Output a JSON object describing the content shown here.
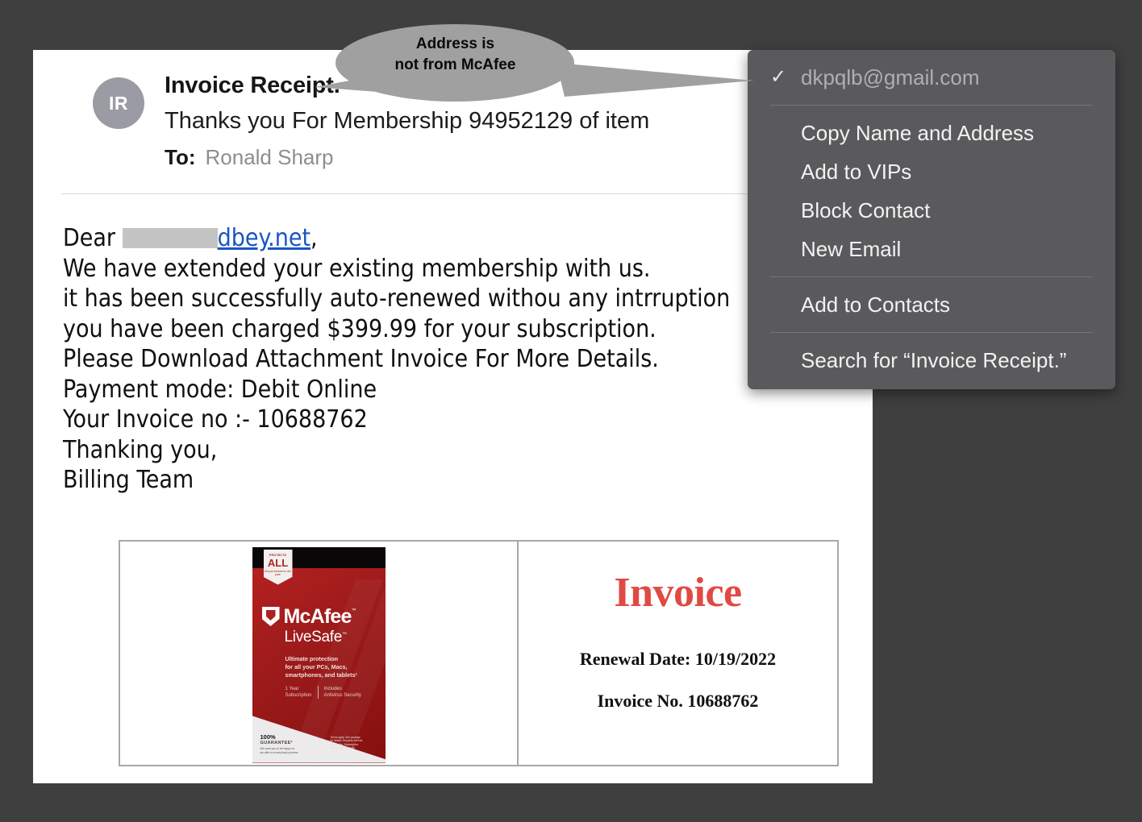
{
  "email": {
    "avatar_initials": "IR",
    "subject": "Invoice Receipt.",
    "preview": "Thanks you For Membership 94952129 of item",
    "to_label": "To:",
    "to_value": "Ronald Sharp",
    "body_lines": {
      "greeting_prefix": "Dear ",
      "greeting_link": "dbey.net",
      "greeting_suffix": ",",
      "line2": "We have extended your existing membership with us.",
      "line3": "it has been successfully auto-renewed withou any intrruption",
      "line4": "you have been charged $399.99 for your subscription.",
      "line5": "Please Download Attachment Invoice For More Details.",
      "line6": "Payment mode: Debit Online",
      "line7": "Your Invoice no :- 10688762",
      "line8": "Thanking you,",
      "line9": "Billing Team"
    }
  },
  "invoice": {
    "title": "Invoice",
    "renewal_date": "Renewal Date: 10/19/2022",
    "invoice_number": "Invoice No. 10688762",
    "title_color": "#e04a44"
  },
  "product_box": {
    "badge_top": "PROTECTS",
    "badge_main": "ALL",
    "badge_bottom": "All your devices\nfor one price",
    "brand": "McAfee",
    "brand_tm": "™",
    "product": "LiveSafe",
    "product_tm": "™",
    "description": "Ultimate protection\nfor all your PCs, Macs,\nsmartphones, and tablets¹",
    "meta_left": "1 Year\nSubscription",
    "meta_right": "Includes\nAntivirus Security",
    "guarantee_title": "100%",
    "guarantee_sub": "GUARANTEE²",
    "guarantee_note": "We want you to be happy so\nwe offer a money back promise",
    "fine_text": "Terms apply. See package\nfor details. Requires internet\nconnection. Subscription\nauto-renews annually."
  },
  "context_menu": {
    "items": [
      {
        "label": "dkpqlb@gmail.com",
        "checked": true,
        "dim": true
      },
      {
        "label": "Copy Name and Address",
        "checked": false,
        "dim": false
      },
      {
        "label": "Add to VIPs",
        "checked": false,
        "dim": false
      },
      {
        "label": "Block Contact",
        "checked": false,
        "dim": false
      },
      {
        "label": "New Email",
        "checked": false,
        "dim": false
      },
      {
        "label": "Add to Contacts",
        "checked": false,
        "dim": false
      },
      {
        "label": "Search for “Invoice Receipt.”",
        "checked": false,
        "dim": false
      }
    ],
    "check_glyph": "✓",
    "background_color": "#5a5a5d"
  },
  "callout": {
    "line1": "Address is",
    "line2": "not from McAfee",
    "fill_color": "#a0a0a0"
  },
  "canvas": {
    "background_color": "#403f40"
  }
}
